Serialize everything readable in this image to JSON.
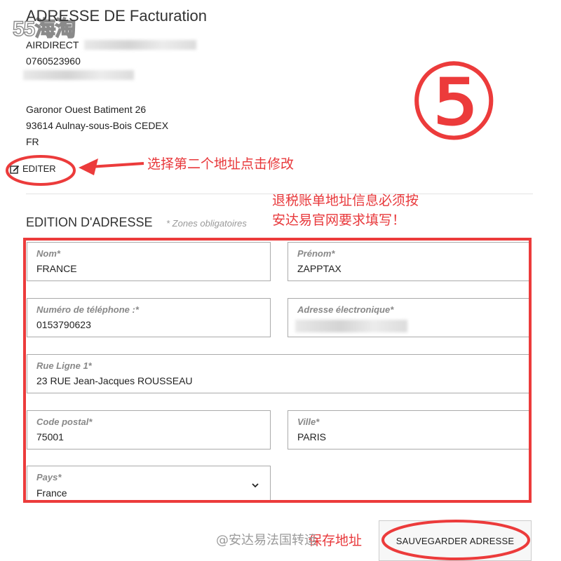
{
  "watermark": {
    "logo": "55海淘"
  },
  "billing": {
    "title": "ADRESSE DE Facturation",
    "company": "AIRDIRECT",
    "phone": "0760523960",
    "street": "Garonor Ouest Batiment 26",
    "city_line": "93614 Aulnay-sous-Bois CEDEX",
    "country": "FR",
    "edit_label": "EDITER"
  },
  "edition": {
    "title": "EDITION D'ADRESSE",
    "required_note": "* Zones obligatoires"
  },
  "form": {
    "nom": {
      "label": "Nom*",
      "value": "FRANCE"
    },
    "prenom": {
      "label": "Prénom*",
      "value": "ZAPPTAX"
    },
    "telephone": {
      "label": "Numéro de téléphone :*",
      "value": "0153790623"
    },
    "email": {
      "label": "Adresse électronique*"
    },
    "rue": {
      "label": "Rue Ligne 1*",
      "value": "23 RUE Jean-Jacques ROUSSEAU"
    },
    "code_postal": {
      "label": "Code postal*",
      "value": "75001"
    },
    "ville": {
      "label": "Ville*",
      "value": "PARIS"
    },
    "pays": {
      "label": "Pays*",
      "value": "France"
    }
  },
  "save_button": "SAUVEGARDER ADRESSE",
  "annotations": {
    "step_number": "⑤",
    "edit_hint": "选择第二个地址点击修改",
    "tax_hint_line1": "退税账单地址信息必须按",
    "tax_hint_line2": "安达易官网要求填写！",
    "save_hint": "保存地址",
    "weibo": "@安达易法国转运"
  },
  "colors": {
    "annotation_red": "#ec3b3b"
  },
  "icons": {
    "edit": "edit-icon",
    "dropdown": "chevron-down-icon"
  }
}
